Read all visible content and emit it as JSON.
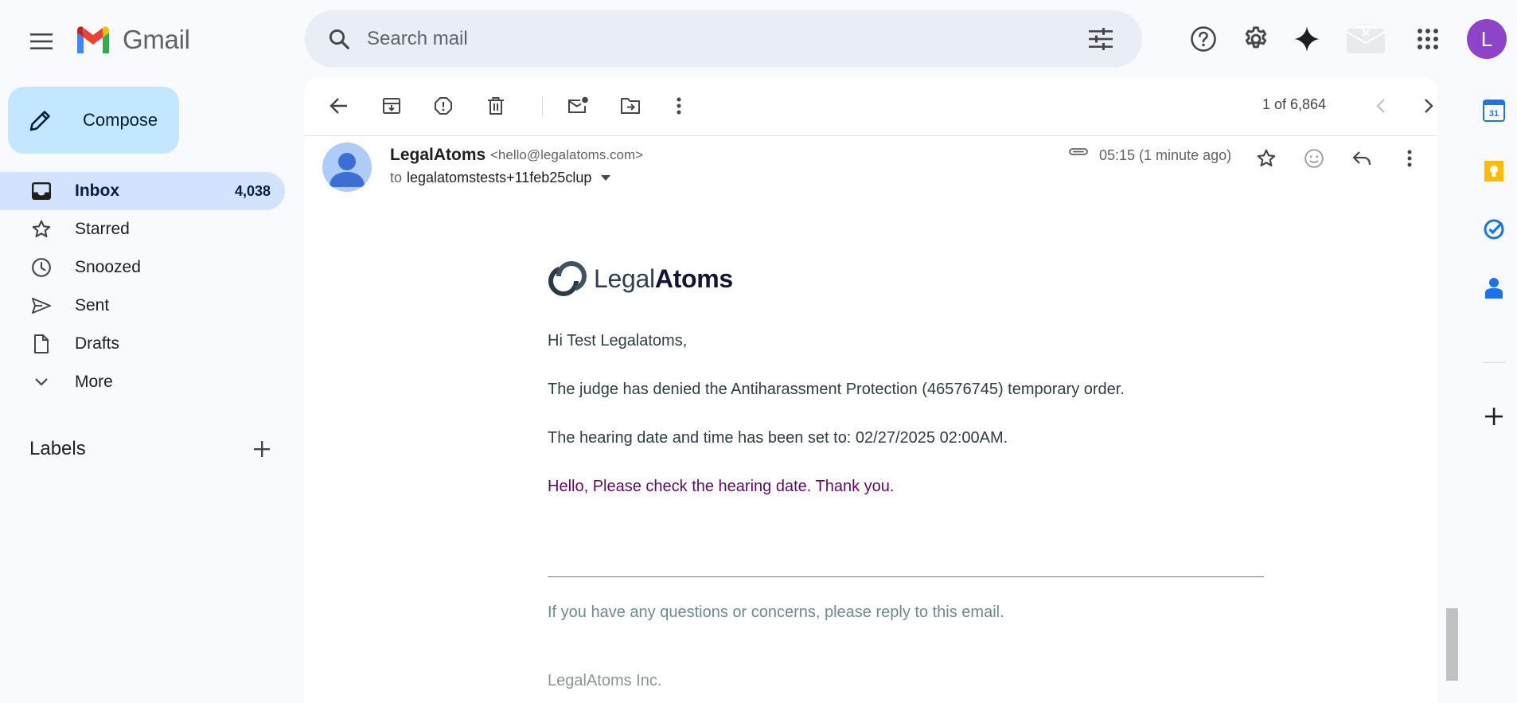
{
  "app": {
    "name": "Gmail"
  },
  "search": {
    "placeholder": "Search mail"
  },
  "user": {
    "initial": "L",
    "avatar_color": "#8e44c9"
  },
  "compose": {
    "label": "Compose"
  },
  "nav": {
    "items": [
      {
        "label": "Inbox",
        "count": "4,038",
        "icon": "inbox-icon",
        "active": true
      },
      {
        "label": "Starred",
        "count": "",
        "icon": "star-icon"
      },
      {
        "label": "Snoozed",
        "count": "",
        "icon": "clock-icon"
      },
      {
        "label": "Sent",
        "count": "",
        "icon": "send-icon"
      },
      {
        "label": "Drafts",
        "count": "",
        "icon": "draft-icon"
      },
      {
        "label": "More",
        "count": "",
        "icon": "chevron-down-icon"
      }
    ]
  },
  "labels": {
    "title": "Labels"
  },
  "toolbar": {
    "pager": "1 of 6,864"
  },
  "message": {
    "sender_name": "LegalAtoms",
    "sender_email": "<hello@legalatoms.com>",
    "to_prefix": "to",
    "recipient": "legalatomstests+11feb25clup",
    "time": "05:15 (1 minute ago)",
    "brand_light": "Legal",
    "brand_bold": "Atoms",
    "greeting": "Hi Test Legalatoms,",
    "line1": "The judge has denied the Antiharassment Protection (46576745) temporary order.",
    "line2": "The hearing date and time has been set to: 02/27/2025 02:00AM.",
    "line3": "Hello, Please check the hearing date. Thank you.",
    "footer": "If you have any questions or concerns, please reply to this email.",
    "company": "LegalAtoms Inc."
  },
  "rail": {
    "calendar_day": "31"
  },
  "colors": {
    "accent_blue": "#0b57d0",
    "nav_active": "#d3e3fd",
    "compose_bg": "#c2e7ff",
    "message_purple": "#5b0b63"
  }
}
